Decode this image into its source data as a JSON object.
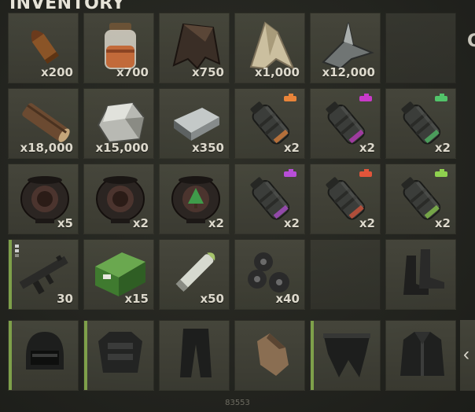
{
  "inventory": {
    "title": "INVENTORY",
    "side_label": "C",
    "footer_id": "83553",
    "next_glyph": "‹",
    "rows": [
      [
        {
          "icon": "bullet-icon",
          "qty": "x200"
        },
        {
          "icon": "jar-icon",
          "qty": "x700"
        },
        {
          "icon": "leather-icon",
          "qty": "x750"
        },
        {
          "icon": "cloth-icon",
          "qty": "x1,000"
        },
        {
          "icon": "metal-fragments-icon",
          "qty": "x12,000"
        },
        {
          "icon": "",
          "qty": ""
        }
      ],
      [
        {
          "icon": "wood-log-icon",
          "qty": "x18,000"
        },
        {
          "icon": "stone-icon",
          "qty": "x15,000"
        },
        {
          "icon": "metal-ingot-icon",
          "qty": "x350"
        },
        {
          "icon": "smoke-grenade-orange-icon",
          "qty": "x2",
          "accent": "#e8843a"
        },
        {
          "icon": "smoke-grenade-magenta-icon",
          "qty": "x2",
          "accent": "#c93ac9"
        },
        {
          "icon": "smoke-grenade-green-icon",
          "qty": "x2",
          "accent": "#52c46a"
        }
      ],
      [
        {
          "icon": "pumpkin-lantern-icon",
          "qty": "x5"
        },
        {
          "icon": "pumpkin-lantern-icon",
          "qty": "x2"
        },
        {
          "icon": "pumpkin-lantern-tree-icon",
          "qty": "x2"
        },
        {
          "icon": "smoke-grenade-purple-icon",
          "qty": "x2",
          "accent": "#b84ed8"
        },
        {
          "icon": "smoke-grenade-red-icon",
          "qty": "x2",
          "accent": "#e2553a"
        },
        {
          "icon": "smoke-grenade-lime-icon",
          "qty": "x2",
          "accent": "#8fd14f"
        }
      ],
      [
        {
          "icon": "smg-rifle-icon",
          "qty": "30",
          "equipped": true,
          "attachments": 3
        },
        {
          "icon": "ammo-box-icon",
          "qty": "x15"
        },
        {
          "icon": "rocket-icon",
          "qty": "x50"
        },
        {
          "icon": "berries-icon",
          "qty": "x40"
        },
        {
          "icon": "",
          "qty": ""
        },
        {
          "icon": "boots-icon",
          "qty": ""
        }
      ]
    ],
    "clothing": [
      {
        "icon": "helmet-icon",
        "equipped": true
      },
      {
        "icon": "chest-armor-icon",
        "equipped": true
      },
      {
        "icon": "pants-icon",
        "equipped": false
      },
      {
        "icon": "gloves-icon",
        "equipped": false
      },
      {
        "icon": "kilt-icon",
        "equipped": true
      },
      {
        "icon": "jacket-icon",
        "equipped": false
      }
    ]
  }
}
